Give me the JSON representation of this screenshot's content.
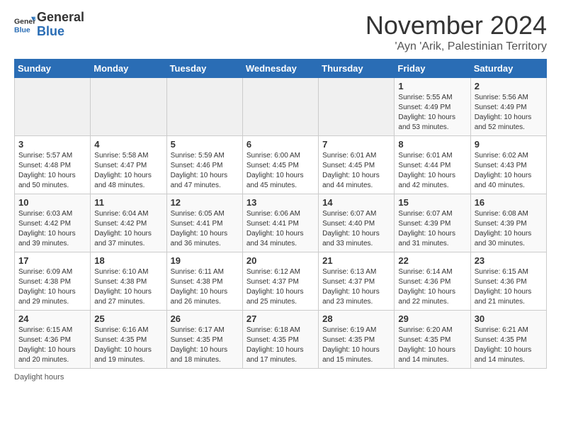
{
  "header": {
    "logo_general": "General",
    "logo_blue": "Blue",
    "title": "November 2024",
    "location": "'Ayn 'Arik, Palestinian Territory"
  },
  "days_of_week": [
    "Sunday",
    "Monday",
    "Tuesday",
    "Wednesday",
    "Thursday",
    "Friday",
    "Saturday"
  ],
  "weeks": [
    [
      {
        "day": "",
        "info": ""
      },
      {
        "day": "",
        "info": ""
      },
      {
        "day": "",
        "info": ""
      },
      {
        "day": "",
        "info": ""
      },
      {
        "day": "",
        "info": ""
      },
      {
        "day": "1",
        "info": "Sunrise: 5:55 AM\nSunset: 4:49 PM\nDaylight: 10 hours and 53 minutes."
      },
      {
        "day": "2",
        "info": "Sunrise: 5:56 AM\nSunset: 4:49 PM\nDaylight: 10 hours and 52 minutes."
      }
    ],
    [
      {
        "day": "3",
        "info": "Sunrise: 5:57 AM\nSunset: 4:48 PM\nDaylight: 10 hours and 50 minutes."
      },
      {
        "day": "4",
        "info": "Sunrise: 5:58 AM\nSunset: 4:47 PM\nDaylight: 10 hours and 48 minutes."
      },
      {
        "day": "5",
        "info": "Sunrise: 5:59 AM\nSunset: 4:46 PM\nDaylight: 10 hours and 47 minutes."
      },
      {
        "day": "6",
        "info": "Sunrise: 6:00 AM\nSunset: 4:45 PM\nDaylight: 10 hours and 45 minutes."
      },
      {
        "day": "7",
        "info": "Sunrise: 6:01 AM\nSunset: 4:45 PM\nDaylight: 10 hours and 44 minutes."
      },
      {
        "day": "8",
        "info": "Sunrise: 6:01 AM\nSunset: 4:44 PM\nDaylight: 10 hours and 42 minutes."
      },
      {
        "day": "9",
        "info": "Sunrise: 6:02 AM\nSunset: 4:43 PM\nDaylight: 10 hours and 40 minutes."
      }
    ],
    [
      {
        "day": "10",
        "info": "Sunrise: 6:03 AM\nSunset: 4:42 PM\nDaylight: 10 hours and 39 minutes."
      },
      {
        "day": "11",
        "info": "Sunrise: 6:04 AM\nSunset: 4:42 PM\nDaylight: 10 hours and 37 minutes."
      },
      {
        "day": "12",
        "info": "Sunrise: 6:05 AM\nSunset: 4:41 PM\nDaylight: 10 hours and 36 minutes."
      },
      {
        "day": "13",
        "info": "Sunrise: 6:06 AM\nSunset: 4:41 PM\nDaylight: 10 hours and 34 minutes."
      },
      {
        "day": "14",
        "info": "Sunrise: 6:07 AM\nSunset: 4:40 PM\nDaylight: 10 hours and 33 minutes."
      },
      {
        "day": "15",
        "info": "Sunrise: 6:07 AM\nSunset: 4:39 PM\nDaylight: 10 hours and 31 minutes."
      },
      {
        "day": "16",
        "info": "Sunrise: 6:08 AM\nSunset: 4:39 PM\nDaylight: 10 hours and 30 minutes."
      }
    ],
    [
      {
        "day": "17",
        "info": "Sunrise: 6:09 AM\nSunset: 4:38 PM\nDaylight: 10 hours and 29 minutes."
      },
      {
        "day": "18",
        "info": "Sunrise: 6:10 AM\nSunset: 4:38 PM\nDaylight: 10 hours and 27 minutes."
      },
      {
        "day": "19",
        "info": "Sunrise: 6:11 AM\nSunset: 4:38 PM\nDaylight: 10 hours and 26 minutes."
      },
      {
        "day": "20",
        "info": "Sunrise: 6:12 AM\nSunset: 4:37 PM\nDaylight: 10 hours and 25 minutes."
      },
      {
        "day": "21",
        "info": "Sunrise: 6:13 AM\nSunset: 4:37 PM\nDaylight: 10 hours and 23 minutes."
      },
      {
        "day": "22",
        "info": "Sunrise: 6:14 AM\nSunset: 4:36 PM\nDaylight: 10 hours and 22 minutes."
      },
      {
        "day": "23",
        "info": "Sunrise: 6:15 AM\nSunset: 4:36 PM\nDaylight: 10 hours and 21 minutes."
      }
    ],
    [
      {
        "day": "24",
        "info": "Sunrise: 6:15 AM\nSunset: 4:36 PM\nDaylight: 10 hours and 20 minutes."
      },
      {
        "day": "25",
        "info": "Sunrise: 6:16 AM\nSunset: 4:35 PM\nDaylight: 10 hours and 19 minutes."
      },
      {
        "day": "26",
        "info": "Sunrise: 6:17 AM\nSunset: 4:35 PM\nDaylight: 10 hours and 18 minutes."
      },
      {
        "day": "27",
        "info": "Sunrise: 6:18 AM\nSunset: 4:35 PM\nDaylight: 10 hours and 17 minutes."
      },
      {
        "day": "28",
        "info": "Sunrise: 6:19 AM\nSunset: 4:35 PM\nDaylight: 10 hours and 15 minutes."
      },
      {
        "day": "29",
        "info": "Sunrise: 6:20 AM\nSunset: 4:35 PM\nDaylight: 10 hours and 14 minutes."
      },
      {
        "day": "30",
        "info": "Sunrise: 6:21 AM\nSunset: 4:35 PM\nDaylight: 10 hours and 14 minutes."
      }
    ]
  ],
  "footer": {
    "daylight_label": "Daylight hours"
  }
}
